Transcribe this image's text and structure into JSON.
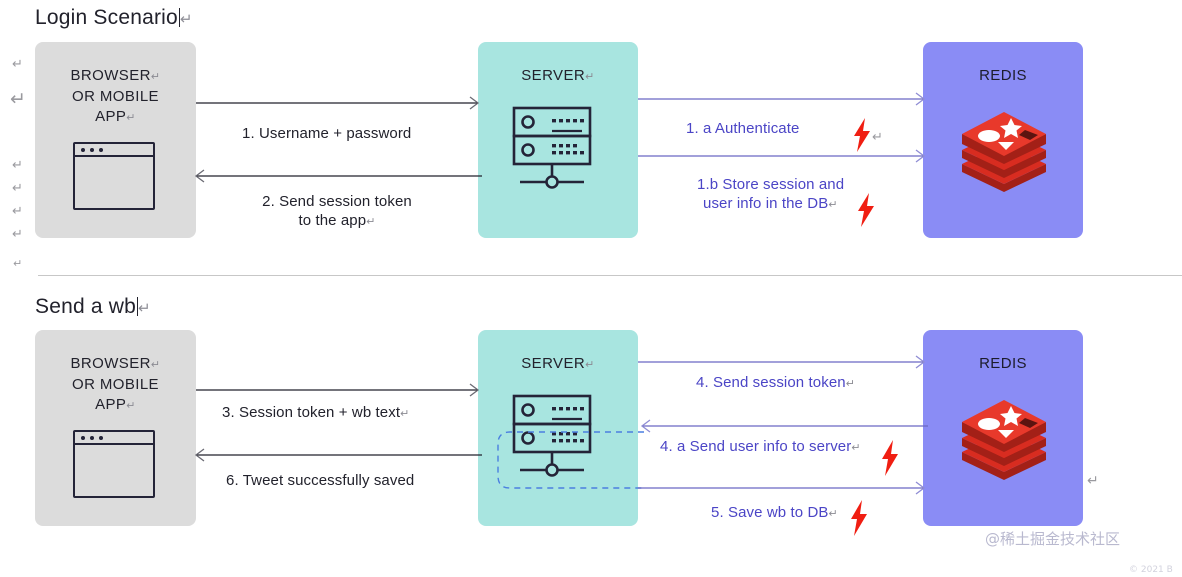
{
  "page": {
    "watermark_main": "@稀土掘金技术社区",
    "watermark_sub": "© 2021 B",
    "pilcrow": "↵"
  },
  "sections": [
    {
      "id": "login",
      "title": "Login Scenario",
      "has_caret": true
    },
    {
      "id": "sendwb",
      "title": "Send a wb",
      "has_caret": true
    }
  ],
  "nodes": {
    "client": {
      "label_line1": "BROWSER",
      "label_line2": "OR MOBILE",
      "label_line3": "APP",
      "icon": "browser-window-icon",
      "color": "#dcdcdc"
    },
    "server": {
      "label": "SERVER",
      "icon": "server-rack-icon",
      "color": "#a8e5e0"
    },
    "redis": {
      "label": "REDIS",
      "icon": "redis-logo-icon",
      "color": "#8a8cf5"
    }
  },
  "flows": {
    "login": [
      {
        "step": "1.",
        "text": "1. Username + password",
        "direction": "right",
        "style": "dark"
      },
      {
        "step": "2.",
        "text": "2. Send session token",
        "text2": "to the app",
        "direction": "left",
        "style": "dark"
      },
      {
        "step": "1.a",
        "text": "1. a Authenticate",
        "direction": "right",
        "style": "purple",
        "bolt": true
      },
      {
        "step": "1.b",
        "text": "1.b Store session and",
        "text2": "user info in the DB",
        "direction": "right",
        "style": "purple",
        "bolt": true
      }
    ],
    "sendwb": [
      {
        "step": "3.",
        "text": "3. Session token + wb text",
        "direction": "right",
        "style": "dark"
      },
      {
        "step": "6.",
        "text": "6. Tweet successfully saved",
        "direction": "left",
        "style": "dark"
      },
      {
        "step": "4.",
        "text": "4. Send session token",
        "direction": "right",
        "style": "purple"
      },
      {
        "step": "4.a",
        "text": "4. a Send user info to server",
        "direction": "left",
        "style": "purple",
        "bolt": true
      },
      {
        "step": "5.",
        "text": "5. Save wb to DB",
        "direction": "right",
        "style": "purple",
        "bolt": true
      }
    ]
  },
  "colors": {
    "client_bg": "#dcdcdc",
    "server_bg": "#a8e5e0",
    "redis_bg": "#8a8cf5",
    "redis_logo": "#d82c20",
    "purple_text": "#4b45c6",
    "purple_arrow": "#6a67c4",
    "dark_arrow": "#22222c",
    "bolt": "#f01e12",
    "divider": "#c7c7c7"
  }
}
